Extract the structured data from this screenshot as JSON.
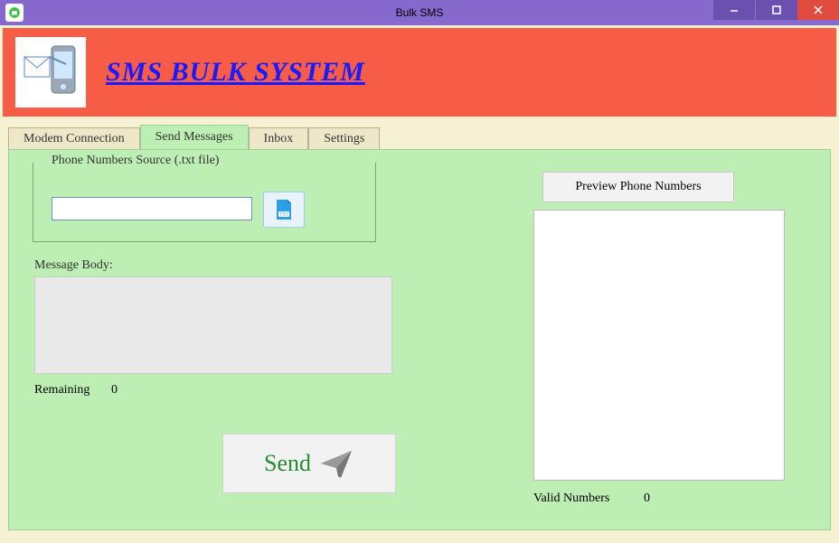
{
  "window": {
    "title": "Bulk SMS"
  },
  "banner": {
    "title": "SMS BULK SYSTEM"
  },
  "tabs": [
    {
      "label": "Modem Connection"
    },
    {
      "label": "Send Messages"
    },
    {
      "label": "Inbox"
    },
    {
      "label": "Settings"
    }
  ],
  "active_tab_index": 1,
  "send_panel": {
    "source_group_label": "Phone Numbers Source (.txt file)",
    "file_path": "",
    "message_body_label": "Message Body:",
    "message_body": "",
    "remaining_label": "Remaining",
    "remaining_value": "0",
    "send_label": "Send",
    "preview_button_label": "Preview Phone Numbers",
    "valid_label": "Valid Numbers",
    "valid_value": "0",
    "preview_items": []
  }
}
